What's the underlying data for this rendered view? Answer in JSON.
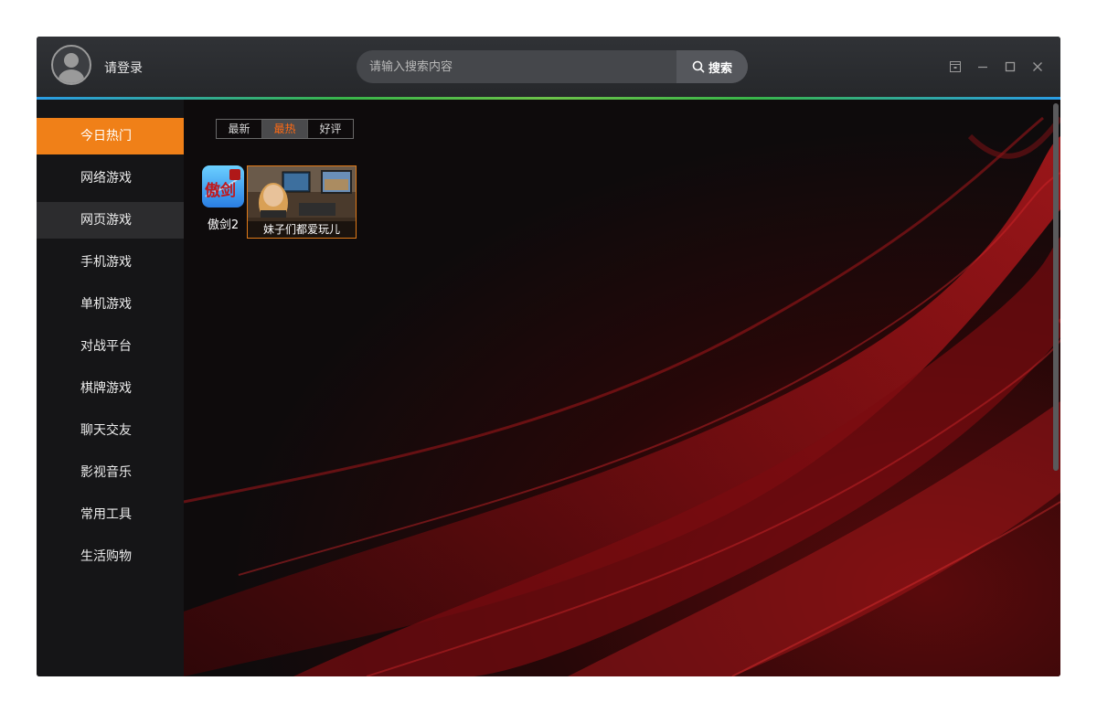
{
  "header": {
    "login_label": "请登录",
    "search_placeholder": "请输入搜索内容",
    "search_button": "搜索"
  },
  "window_controls": [
    "skin-icon",
    "minimize-icon",
    "maximize-icon",
    "close-icon"
  ],
  "sidebar": {
    "items": [
      {
        "label": "今日热门"
      },
      {
        "label": "网络游戏"
      },
      {
        "label": "网页游戏"
      },
      {
        "label": "手机游戏"
      },
      {
        "label": "单机游戏"
      },
      {
        "label": "对战平台"
      },
      {
        "label": "棋牌游戏"
      },
      {
        "label": "聊天交友"
      },
      {
        "label": "影视音乐"
      },
      {
        "label": "常用工具"
      },
      {
        "label": "生活购物"
      }
    ],
    "active_index": 0
  },
  "filter_tabs": {
    "items": [
      "最新",
      "最热",
      "好评"
    ],
    "active_index": 1
  },
  "apps": [
    {
      "name": "傲剑2",
      "icon_text": "傲剑"
    }
  ],
  "promo": {
    "caption": "妹子们都爱玩儿"
  },
  "colors": {
    "accent_orange": "#f08018",
    "active_tab_text": "#ff6a13",
    "titlebar": "#2b2d30",
    "accent_line_blue": "#2a9de6",
    "accent_line_green": "#6cc24a"
  }
}
